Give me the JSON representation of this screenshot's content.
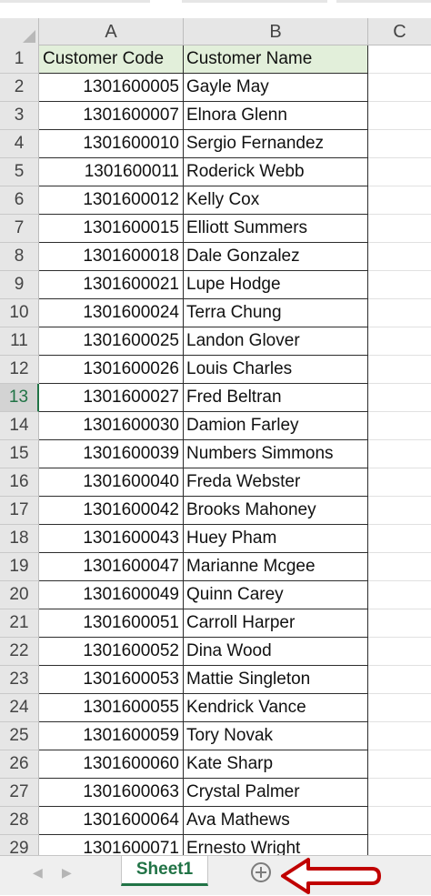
{
  "columns": [
    "A",
    "B",
    "C"
  ],
  "rows": [
    {
      "num": "1",
      "code": "Customer Code",
      "name": "Customer Name"
    },
    {
      "num": "2",
      "code": "1301600005",
      "name": "Gayle May"
    },
    {
      "num": "3",
      "code": "1301600007",
      "name": "Elnora Glenn"
    },
    {
      "num": "4",
      "code": "1301600010",
      "name": "Sergio Fernandez"
    },
    {
      "num": "5",
      "code": "1301600011",
      "name": "Roderick Webb"
    },
    {
      "num": "6",
      "code": "1301600012",
      "name": "Kelly Cox"
    },
    {
      "num": "7",
      "code": "1301600015",
      "name": "Elliott Summers"
    },
    {
      "num": "8",
      "code": "1301600018",
      "name": "Dale Gonzalez"
    },
    {
      "num": "9",
      "code": "1301600021",
      "name": "Lupe Hodge"
    },
    {
      "num": "10",
      "code": "1301600024",
      "name": "Terra Chung"
    },
    {
      "num": "11",
      "code": "1301600025",
      "name": "Landon Glover"
    },
    {
      "num": "12",
      "code": "1301600026",
      "name": "Louis Charles"
    },
    {
      "num": "13",
      "code": "1301600027",
      "name": "Fred Beltran"
    },
    {
      "num": "14",
      "code": "1301600030",
      "name": "Damion Farley"
    },
    {
      "num": "15",
      "code": "1301600039",
      "name": "Numbers Simmons"
    },
    {
      "num": "16",
      "code": "1301600040",
      "name": "Freda Webster"
    },
    {
      "num": "17",
      "code": "1301600042",
      "name": "Brooks Mahoney"
    },
    {
      "num": "18",
      "code": "1301600043",
      "name": "Huey Pham"
    },
    {
      "num": "19",
      "code": "1301600047",
      "name": "Marianne Mcgee"
    },
    {
      "num": "20",
      "code": "1301600049",
      "name": "Quinn Carey"
    },
    {
      "num": "21",
      "code": "1301600051",
      "name": "Carroll Harper"
    },
    {
      "num": "22",
      "code": "1301600052",
      "name": "Dina Wood"
    },
    {
      "num": "23",
      "code": "1301600053",
      "name": "Mattie Singleton"
    },
    {
      "num": "24",
      "code": "1301600055",
      "name": "Kendrick Vance"
    },
    {
      "num": "25",
      "code": "1301600059",
      "name": "Tory Novak"
    },
    {
      "num": "26",
      "code": "1301600060",
      "name": "Kate Sharp"
    },
    {
      "num": "27",
      "code": "1301600063",
      "name": "Crystal Palmer"
    },
    {
      "num": "28",
      "code": "1301600064",
      "name": "Ava Mathews"
    },
    {
      "num": "29",
      "code": "1301600071",
      "name": "Ernesto Wright"
    }
  ],
  "active_row": "13",
  "sheet_tab": {
    "label": "Sheet1"
  },
  "icons": {
    "scroll_left": "triangle-left-icon",
    "scroll_right": "triangle-right-icon",
    "add_sheet": "plus-circle-icon",
    "annotation": "red-arrow-icon"
  },
  "colors": {
    "header_fill": "#e2efda",
    "excel_green": "#217346",
    "arrow_red": "#c00000"
  }
}
